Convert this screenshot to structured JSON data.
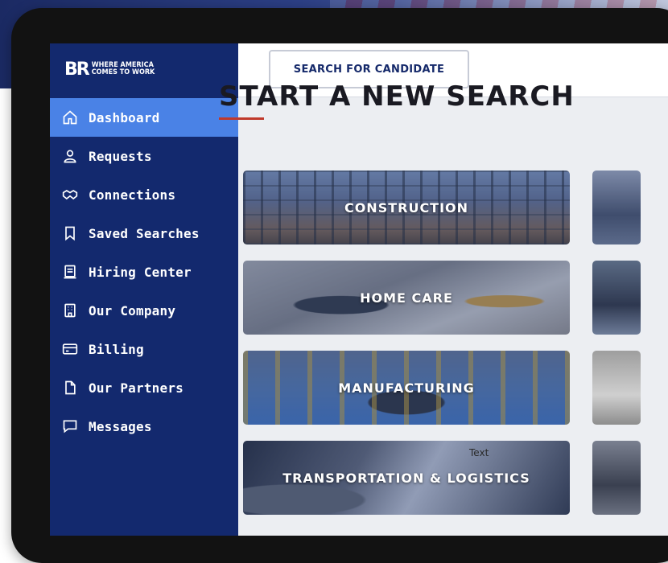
{
  "brand": {
    "mark": "BR",
    "tagline_line1": "WHERE AMERICA",
    "tagline_line2": "COMES TO WORK"
  },
  "sidebar": {
    "items": [
      {
        "label": "Dashboard",
        "icon": "home-icon",
        "active": true
      },
      {
        "label": "Requests",
        "icon": "user-icon",
        "active": false
      },
      {
        "label": "Connections",
        "icon": "handshake-icon",
        "active": false
      },
      {
        "label": "Saved Searches",
        "icon": "bookmark-icon",
        "active": false
      },
      {
        "label": "Hiring Center",
        "icon": "document-icon",
        "active": false
      },
      {
        "label": "Our Company",
        "icon": "building-icon",
        "active": false
      },
      {
        "label": "Billing",
        "icon": "credit-card-icon",
        "active": false
      },
      {
        "label": "Our Partners",
        "icon": "file-icon",
        "active": false
      },
      {
        "label": "Messages",
        "icon": "chat-icon",
        "active": false
      }
    ]
  },
  "header": {
    "search_button_label": "SEARCH FOR CANDIDATE"
  },
  "main": {
    "title": "START A NEW SEARCH",
    "categories": [
      {
        "label": "CONSTRUCTION"
      },
      {
        "label": "HOME CARE"
      },
      {
        "label": "MANUFACTURING"
      },
      {
        "label": "TRANSPORTATION & LOGISTICS"
      }
    ],
    "overlay_text": "Text"
  },
  "colors": {
    "sidebar_bg": "#13296e",
    "active_item": "#4a82e6",
    "accent_underline": "#c0392b",
    "title_text": "#1a1a22"
  }
}
